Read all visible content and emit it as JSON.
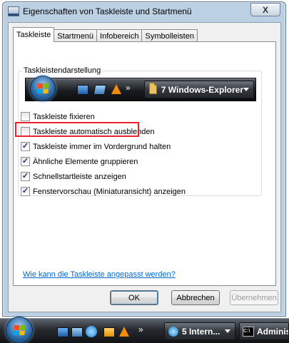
{
  "window": {
    "title": "Eigenschaften von Taskleiste und Startmenü",
    "close_glyph": "X"
  },
  "tabs": [
    {
      "label": "Taskleiste",
      "active": true
    },
    {
      "label": "Startmenü",
      "active": false
    },
    {
      "label": "Infobereich",
      "active": false
    },
    {
      "label": "Symbolleisten",
      "active": false
    }
  ],
  "group": {
    "legend": "Taskleistendarstellung",
    "preview": {
      "explorer_label": "7 Windows-Explorer",
      "more_glyph": "»"
    },
    "options": [
      {
        "label": "Taskleiste fixieren",
        "checked": false
      },
      {
        "label": "Taskleiste automatisch ausblenden",
        "checked": false
      },
      {
        "label": "Taskleiste immer im Vordergrund halten",
        "checked": true
      },
      {
        "label": "Ähnliche Elemente gruppieren",
        "checked": true
      },
      {
        "label": "Schnellstartleiste anzeigen",
        "checked": true
      },
      {
        "label": "Fenstervorschau (Miniaturansicht) anzeigen",
        "checked": true
      }
    ]
  },
  "help_link": "Wie kann die Taskleiste angepasst werden?",
  "buttons": {
    "ok": "OK",
    "cancel": "Abbrechen",
    "apply": "Übernehmen"
  },
  "taskbar": {
    "more_glyph": "»",
    "ie_label": "5 Intern...",
    "cmd_label": "Adminis",
    "cmd_icon_text": "C:\\"
  },
  "colors": {
    "highlight": "#e8232e",
    "link": "#0066cc",
    "flag_red": "#f25022",
    "flag_green": "#7fba00",
    "flag_blue": "#00a4ef",
    "flag_yellow": "#ffb900"
  }
}
